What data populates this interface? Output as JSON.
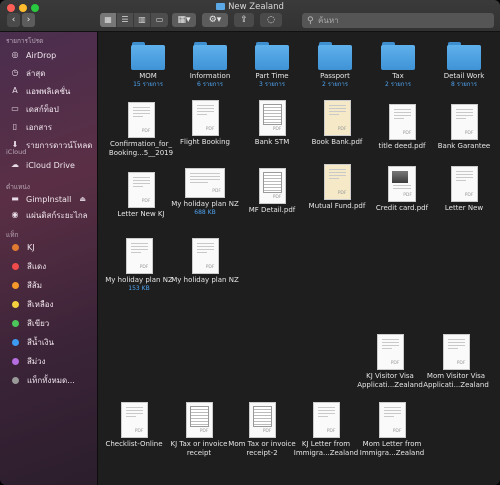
{
  "window": {
    "title": "New Zealand"
  },
  "toolbar": {
    "back": "‹",
    "forward": "›",
    "search_placeholder": "ค้นหา"
  },
  "sidebar": {
    "favorites_header": "รายการโปรด",
    "favorites": [
      {
        "label": "AirDrop",
        "icon": "airdrop-icon",
        "glyph": "◎"
      },
      {
        "label": "ล่าสุด",
        "icon": "recents-icon",
        "glyph": "◷"
      },
      {
        "label": "แอพพลิเคชั่น",
        "icon": "applications-icon",
        "glyph": "A"
      },
      {
        "label": "เดสก์ท็อป",
        "icon": "desktop-icon",
        "glyph": "▭"
      },
      {
        "label": "เอกสาร",
        "icon": "documents-icon",
        "glyph": "▯"
      },
      {
        "label": "รายการดาวน์โหลด",
        "icon": "downloads-icon",
        "glyph": "⬇"
      }
    ],
    "icloud_header": "iCloud",
    "icloud": [
      {
        "label": "iCloud Drive",
        "icon": "cloud-icon",
        "glyph": "☁"
      }
    ],
    "locations_header": "ตำแหน่ง",
    "locations": [
      {
        "label": "GimpInstall",
        "icon": "disk-icon",
        "glyph": "▬"
      },
      {
        "label": "แผ่นดิสก์ระยะไกล",
        "icon": "remote-disc-icon",
        "glyph": "◉"
      }
    ],
    "eject_glyph": "⏏",
    "tags_header": "แท็ก",
    "tags": [
      {
        "label": "KJ",
        "color": "#e07a30"
      },
      {
        "label": "สีแดง",
        "color": "#f04b4b"
      },
      {
        "label": "สีส้ม",
        "color": "#f5992b"
      },
      {
        "label": "สีเหลือง",
        "color": "#f4d03f"
      },
      {
        "label": "สีเขียว",
        "color": "#4cc65a"
      },
      {
        "label": "สีน้ำเงิน",
        "color": "#3d9bf3"
      },
      {
        "label": "สีม่วง",
        "color": "#b46ee0"
      },
      {
        "label": "แท็กทั้งหมด...",
        "color": "#9a9a9a"
      }
    ]
  },
  "files": [
    {
      "kind": "folder",
      "label": "MOM",
      "sub": "15 รายการ"
    },
    {
      "kind": "folder",
      "label": "Information",
      "sub": "6 รายการ"
    },
    {
      "kind": "folder",
      "label": "Part Time",
      "sub": "3 รายการ"
    },
    {
      "kind": "folder",
      "label": "Passport",
      "sub": "2 รายการ"
    },
    {
      "kind": "folder",
      "label": "Tax",
      "sub": "2 รายการ"
    },
    {
      "kind": "folder",
      "label": "Detail Work",
      "sub": "8 รายการ"
    },
    {
      "kind": "pdf",
      "label": "Confirmation_for_ Booking...5__2019",
      "sub": ""
    },
    {
      "kind": "pdf",
      "label": "Flight Booking",
      "sub": ""
    },
    {
      "kind": "table",
      "label": "Bank STM",
      "sub": ""
    },
    {
      "kind": "cream",
      "label": "Book Bank.pdf",
      "sub": ""
    },
    {
      "kind": "pdf",
      "label": "title deed.pdf",
      "sub": ""
    },
    {
      "kind": "pdf",
      "label": "Bank Garantee",
      "sub": ""
    },
    {
      "kind": "pdf",
      "label": "Letter New KJ",
      "sub": ""
    },
    {
      "kind": "wide",
      "label": "My holiday plan NZ",
      "sub": "688 KB"
    },
    {
      "kind": "table",
      "label": "MF Detail.pdf",
      "sub": ""
    },
    {
      "kind": "cream",
      "label": "Mutual Fund.pdf",
      "sub": ""
    },
    {
      "kind": "photo",
      "label": "Credit card.pdf",
      "sub": ""
    },
    {
      "kind": "pdf",
      "label": "Letter New",
      "sub": ""
    },
    {
      "kind": "pdf",
      "label": "My holiday plan NZ",
      "sub": "153 KB"
    },
    {
      "kind": "pdf",
      "label": "My holiday plan NZ",
      "sub": ""
    },
    {
      "kind": "pdf",
      "label": "KJ Visitor Visa Applicati...Zealand",
      "sub": ""
    },
    {
      "kind": "pdf",
      "label": "Mom Visitor Visa Applicati...Zealand",
      "sub": ""
    },
    {
      "kind": "pdf",
      "label": "Checklist-Online",
      "sub": ""
    },
    {
      "kind": "table",
      "label": "KJ Tax or invoice receipt",
      "sub": ""
    },
    {
      "kind": "table",
      "label": "Mom Tax or invoice receipt-2",
      "sub": ""
    },
    {
      "kind": "pdf",
      "label": "KJ Letter from Immigra...Zealand",
      "sub": ""
    },
    {
      "kind": "pdf",
      "label": "Mom Letter from Immigra...Zealand",
      "sub": ""
    }
  ],
  "pdf_tag": "PDF",
  "colors": {
    "traffic_close": "#fe5f57",
    "traffic_min": "#febc2e",
    "traffic_max": "#28c840",
    "sub_text": "#4fa3f0"
  }
}
